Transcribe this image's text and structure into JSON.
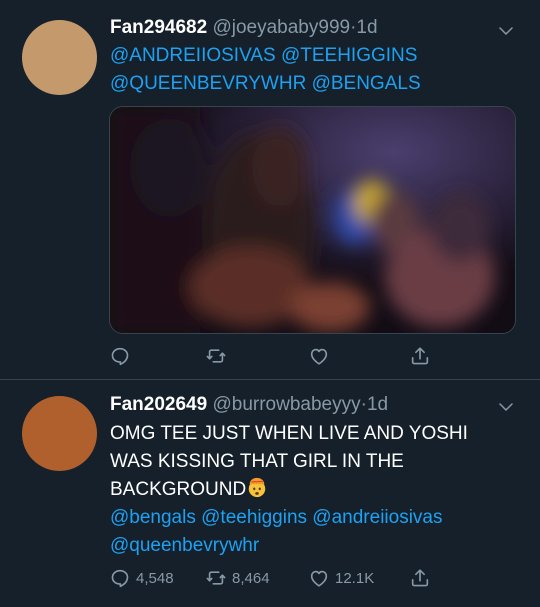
{
  "tweets": [
    {
      "display_name": "Fan294682",
      "handle": "@joeyababy999",
      "separator": "·",
      "time": "1d",
      "avatar_color": "#c49a6c",
      "text_lines": [],
      "mention_lines": [
        "@ANDREIIOSIVAS @TEEHIGGINS",
        "@QUEENBEVRYWHR @BENGALS"
      ],
      "has_media": true,
      "counts": {
        "reply": "",
        "retweet": "",
        "like": ""
      }
    },
    {
      "display_name": "Fan202649",
      "handle": "@burrowbabeyyy",
      "separator": "·",
      "time": "1d",
      "avatar_color": "#b0602d",
      "text_lines": [
        "OMG TEE JUST WHEN LIVE AND YOSHI",
        "WAS KISSING THAT GIRL IN THE",
        "BACKGROUND"
      ],
      "emoji": "exploding-head-emoji",
      "mention_lines": [
        "@bengals @teehiggins @andreiiosivas",
        "@queenbevrywhr"
      ],
      "has_media": false,
      "counts": {
        "reply": "4,548",
        "retweet": "8,464",
        "like": "12.1K"
      }
    }
  ],
  "colors": {
    "background": "#15202b",
    "divider": "#38444d",
    "link": "#1da1f2",
    "muted": "#8899a6"
  },
  "icons": [
    "reply-icon",
    "retweet-icon",
    "like-icon",
    "share-icon",
    "chevron-down-icon"
  ]
}
